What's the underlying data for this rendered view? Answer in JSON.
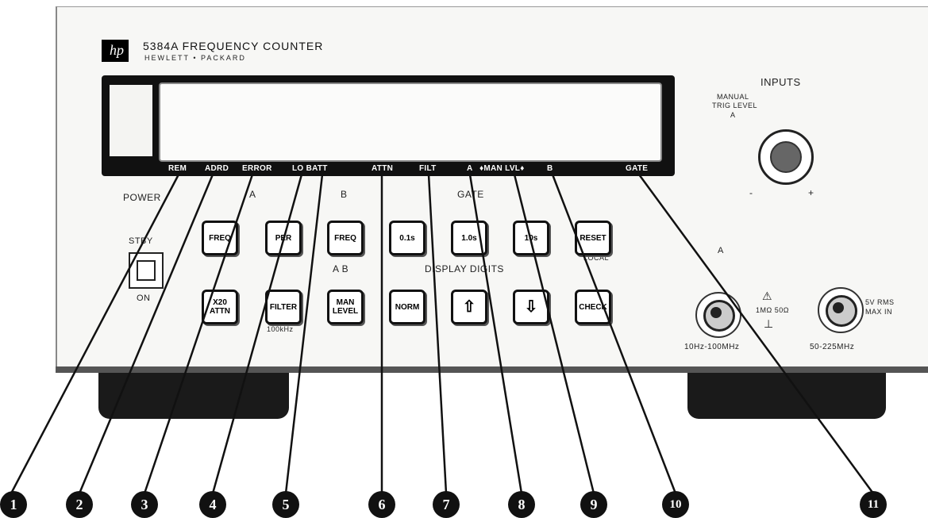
{
  "header": {
    "logo_text": "hp",
    "title": "5384A FREQUENCY COUNTER",
    "brand": "HEWLETT • PACKARD"
  },
  "annunciators": [
    {
      "id": "rem",
      "label": "REM"
    },
    {
      "id": "addr",
      "label": "ADRD"
    },
    {
      "id": "error",
      "label": "ERROR"
    },
    {
      "id": "lobatt",
      "label": "LO BATT"
    },
    {
      "id": "attn",
      "label": "ATTN"
    },
    {
      "id": "filt",
      "label": "FILT"
    },
    {
      "id": "a",
      "label": "A"
    },
    {
      "id": "manlvl",
      "label": "♦MAN LVL♦"
    },
    {
      "id": "b",
      "label": "B"
    },
    {
      "id": "gate",
      "label": "GATE"
    }
  ],
  "section_labels": {
    "power": "POWER",
    "a": "A",
    "b": "B",
    "gate": "GATE",
    "a_b": "A   B",
    "display_digits": "DISPLAY DIGITS",
    "local": "LOCAL",
    "filter_sub": "100kHz",
    "stby": "STBY",
    "on": "ON"
  },
  "buttons": {
    "freq_a": "FREQ",
    "per": "PER",
    "freq_b": "FREQ",
    "gate_01": "0.1s",
    "gate_1": "1.0s",
    "gate_10": "10s",
    "reset": "RESET",
    "x20attn_1": "X20",
    "x20attn_2": "ATTN",
    "filter": "FILTER",
    "manlevel_1": "MAN",
    "manlevel_2": "LEVEL",
    "norm": "NORM",
    "up": "⇧",
    "down": "⇩",
    "check": "CHECK"
  },
  "inputs": {
    "heading": "INPUTS",
    "manual_trig_1": "MANUAL",
    "manual_trig_2": "TRIG LEVEL",
    "manual_trig_3": "A",
    "minus": "-",
    "plus": "+",
    "a_label": "A",
    "warning": "⚠",
    "impedance": "1MΩ 50Ω",
    "ground": "⊥",
    "a_range": "10Hz-100MHz",
    "b_range": "50-225MHz",
    "max_in_1": "5V RMS",
    "max_in_2": "MAX IN"
  },
  "callouts": [
    "1",
    "2",
    "3",
    "4",
    "5",
    "6",
    "7",
    "8",
    "9",
    "10",
    "11"
  ]
}
